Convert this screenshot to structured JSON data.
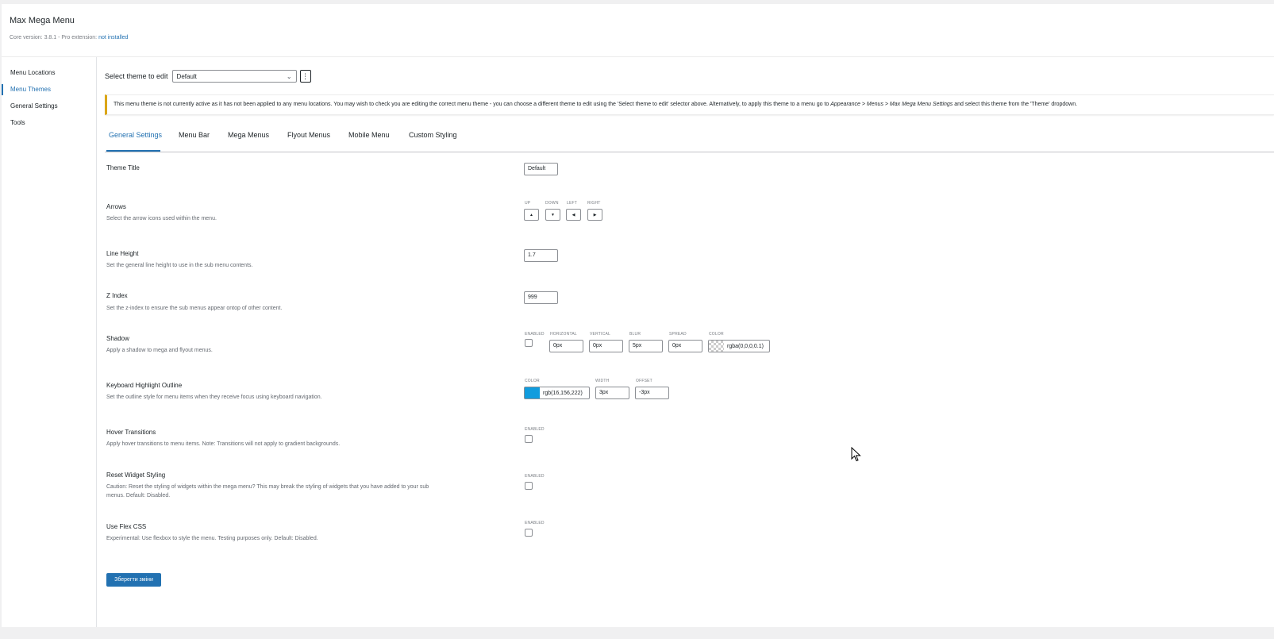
{
  "header": {
    "title": "Max Mega Menu",
    "version_text": "Core version: 3.8.1 - Pro extension: ",
    "pro_status": "not installed"
  },
  "sidebar": {
    "items": [
      {
        "label": "Menu Locations",
        "active": false
      },
      {
        "label": "Menu Themes",
        "active": true
      },
      {
        "label": "General Settings",
        "active": false
      },
      {
        "label": "Tools",
        "active": false
      }
    ]
  },
  "theme_select": {
    "label": "Select theme to edit",
    "value": "Default"
  },
  "notice": {
    "text": "This menu theme is not currently active as it has not been applied to any menu locations. You may wish to check you are editing the correct menu theme - you can choose a different theme to edit using the 'Select theme to edit' selector above. Alternatively, to apply this theme to a menu go to ",
    "path": "Appearance > Menus > Max Mega Menu Settings",
    "text_end": " and select this theme from the 'Theme' dropdown."
  },
  "tabs": [
    {
      "label": "General Settings",
      "active": true
    },
    {
      "label": "Menu Bar",
      "active": false
    },
    {
      "label": "Mega Menus",
      "active": false
    },
    {
      "label": "Flyout Menus",
      "active": false
    },
    {
      "label": "Mobile Menu",
      "active": false
    },
    {
      "label": "Custom Styling",
      "active": false
    }
  ],
  "settings": {
    "theme_title": {
      "title": "Theme Title",
      "value": "Default"
    },
    "arrows": {
      "title": "Arrows",
      "desc": "Select the arrow icons used within the menu.",
      "labels": [
        "UP",
        "DOWN",
        "LEFT",
        "RIGHT"
      ],
      "icons": [
        "▲",
        "▼",
        "◀",
        "▶"
      ]
    },
    "line_height": {
      "title": "Line Height",
      "desc": "Set the general line height to use in the sub menu contents.",
      "value": "1.7"
    },
    "z_index": {
      "title": "Z Index",
      "desc": "Set the z-index to ensure the sub menus appear ontop of other content.",
      "value": "999"
    },
    "shadow": {
      "title": "Shadow",
      "desc": "Apply a shadow to mega and flyout menus.",
      "labels": [
        "ENABLED",
        "HORIZONTAL",
        "VERTICAL",
        "BLUR",
        "SPREAD",
        "COLOR"
      ],
      "horizontal": "0px",
      "vertical": "0px",
      "blur": "5px",
      "spread": "0px",
      "color": "rgba(0,0,0,0.1)"
    },
    "keyboard": {
      "title": "Keyboard Highlight Outline",
      "desc": "Set the outline style for menu items when they receive focus using keyboard navigation.",
      "labels": [
        "COLOR",
        "WIDTH",
        "OFFSET"
      ],
      "color": "rgb(16,156,222)",
      "color_hex": "#109cde",
      "width": "3px",
      "offset": "-3px"
    },
    "hover": {
      "title": "Hover Transitions",
      "desc": "Apply hover transitions to menu items. Note: Transitions will not apply to gradient backgrounds.",
      "label": "ENABLED"
    },
    "reset_widget": {
      "title": "Reset Widget Styling",
      "desc": "Caution: Reset the styling of widgets within the mega menu? This may break the styling of widgets that you have added to your sub menus. Default: Disabled.",
      "label": "ENABLED"
    },
    "flex_css": {
      "title": "Use Flex CSS",
      "desc": "Experimental: Use flexbox to style the menu. Testing purposes only. Default: Disabled.",
      "label": "ENABLED"
    }
  },
  "save_label": "Зберегти зміни"
}
